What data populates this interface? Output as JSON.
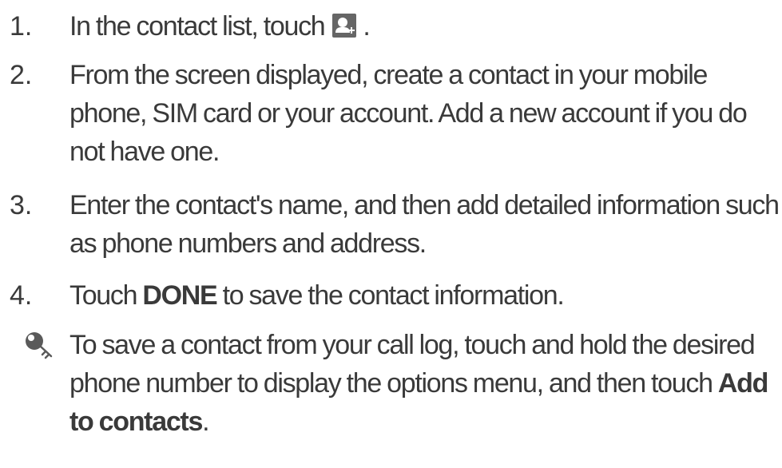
{
  "steps": [
    {
      "number": "1.",
      "text_before": "In the contact list, touch",
      "icon": "add-contact-icon",
      "text_after": "."
    },
    {
      "number": "2.",
      "text": "From the screen displayed, create a contact in your mobile phone, SIM card or your account. Add a new account if you do not have one."
    },
    {
      "number": "3.",
      "text": "Enter the contact's name, and then add detailed information such as phone numbers and address."
    },
    {
      "number": "4.",
      "text_before": "Touch",
      "bold": "DONE",
      "text_after": " to save the contact information."
    }
  ],
  "tip": {
    "icon": "tip-key-icon",
    "text": "To save a contact from your call log, touch and hold the desired phone number to display the options menu, and then touch ",
    "bold": "Add to contacts",
    "text_after": "."
  },
  "colors": {
    "text": "#3a3a3a",
    "icon_bg": "#666666"
  }
}
